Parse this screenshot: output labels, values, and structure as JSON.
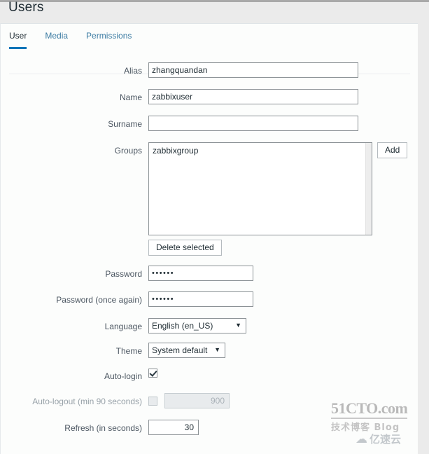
{
  "page": {
    "title": "Users"
  },
  "tabs": [
    {
      "label": "User",
      "active": true
    },
    {
      "label": "Media",
      "active": false
    },
    {
      "label": "Permissions",
      "active": false
    }
  ],
  "form": {
    "alias": {
      "label": "Alias",
      "value": "zhangquandan"
    },
    "name": {
      "label": "Name",
      "value": "zabbixuser"
    },
    "surname": {
      "label": "Surname",
      "value": ""
    },
    "groups": {
      "label": "Groups",
      "options": [
        "zabbixgroup"
      ],
      "add_button": "Add",
      "delete_button": "Delete selected"
    },
    "password": {
      "label": "Password",
      "value": "••••••"
    },
    "password_again": {
      "label": "Password (once again)",
      "value": "••••••"
    },
    "language": {
      "label": "Language",
      "value": "English (en_US)"
    },
    "theme": {
      "label": "Theme",
      "value": "System default"
    },
    "auto_login": {
      "label": "Auto-login",
      "checked": true
    },
    "auto_logout": {
      "label": "Auto-logout (min 90 seconds)",
      "checked": false,
      "value": "900"
    },
    "refresh": {
      "label": "Refresh (in seconds)",
      "value": "30"
    }
  },
  "watermark": {
    "brand": "51CTO.com",
    "tagline": "技术博客    Blog",
    "cloud_icon": "cloud-icon",
    "cloud_text": "亿速云"
  },
  "icons": {
    "dropdown_arrow": "▼"
  },
  "colors": {
    "accent": "#0275b8",
    "link": "#3c7ca3",
    "text": "#1f2c33",
    "panel_bg": "#fcfdfc",
    "page_bg": "#ebebeb"
  }
}
